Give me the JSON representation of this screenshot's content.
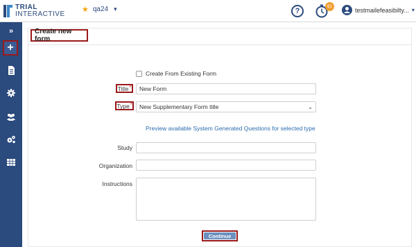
{
  "app": {
    "logo_line1": "TRIAL",
    "logo_line2": "INTERACTIVE",
    "study_name": "qa24",
    "timer_badge": "61",
    "user_name": "testmailefeasibilty..."
  },
  "sidebar": {
    "expand_label": "»",
    "new_label": "+",
    "items": [
      {
        "icon": "document-icon"
      },
      {
        "icon": "gear-icon"
      },
      {
        "icon": "users-icon"
      },
      {
        "icon": "settings-cogs-icon"
      },
      {
        "icon": "table-icon"
      }
    ]
  },
  "form": {
    "header": "Create new form",
    "create_existing_label": "Create From Existing Form",
    "title_label": "Title",
    "title_value": "New Form",
    "type_label": "Type",
    "type_value": "New Supplementary Form title",
    "required_mark": "*",
    "preview_link": "Preview available System Generated Questions for selected type",
    "study_label": "Study",
    "study_value": "",
    "organization_label": "Organization",
    "organization_value": "",
    "instructions_label": "Instructions",
    "instructions_value": "",
    "continue_label": "Continue"
  },
  "colors": {
    "sidebar": "#2b4a7e",
    "highlight_border": "#9a1a1a",
    "button": "#6b8fbe",
    "link": "#2b6cb0",
    "badge": "#f0a030"
  }
}
